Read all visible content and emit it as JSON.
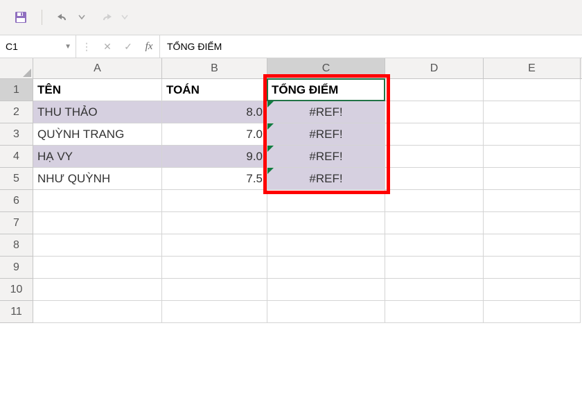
{
  "toolbar": {
    "save": "save-icon",
    "undo": "undo-icon",
    "redo": "redo-icon"
  },
  "formulaBar": {
    "nameBox": "C1",
    "cancel": "✕",
    "enter": "✓",
    "fx": "fx",
    "formula": "TỔNG ĐIỂM"
  },
  "columns": [
    "A",
    "B",
    "C",
    "D",
    "E"
  ],
  "rowCount": 11,
  "selectedColIndex": 2,
  "selectedRowIndex": 0,
  "headers": {
    "A": "TÊN",
    "B": "TOÁN",
    "C": "TỔNG ĐIỂM"
  },
  "data": [
    {
      "A": "THU THẢO",
      "B": "8.0",
      "C": "#REF!"
    },
    {
      "A": "QUỲNH TRANG",
      "B": "7.0",
      "C": "#REF!"
    },
    {
      "A": "HẠ VY",
      "B": "9.0",
      "C": "#REF!"
    },
    {
      "A": "NHƯ QUỲNH",
      "B": "7.5",
      "C": "#REF!"
    }
  ],
  "note": "Column C shows #REF! errors with error-indicator triangles; highlighted by red rectangle."
}
